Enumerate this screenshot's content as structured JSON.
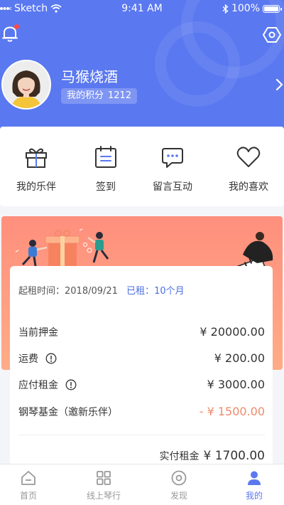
{
  "status_bar": {
    "carrier": "Sketch",
    "time": "9:41 AM",
    "battery": "100%"
  },
  "profile": {
    "name": "马猴烧酒",
    "points_label": "我的积分",
    "points_value": "1212"
  },
  "quick_actions": [
    {
      "label": "我的乐伴",
      "icon": "gift-icon"
    },
    {
      "label": "签到",
      "icon": "calendar-icon"
    },
    {
      "label": "留言互动",
      "icon": "chat-icon"
    },
    {
      "label": "我的喜欢",
      "icon": "heart-icon"
    }
  ],
  "rental": {
    "start_label": "起租时间：",
    "start_date": "2018/09/21",
    "rented_label": "已租：",
    "rented_value": "10个月",
    "deposit_label": "当前押金",
    "deposit_value": "¥ 20000.00",
    "shipping_label": "运费",
    "shipping_value": "¥ 200.00",
    "rent_due_label": "应付租金",
    "rent_due_value": "¥ 3000.00",
    "fund_label": "钢琴基金（邀新乐伴）",
    "fund_value": "- ¥ 1500.00",
    "actual_label": "实付租金",
    "actual_value": "¥ 1700.00"
  },
  "tabs": [
    {
      "label": "首页",
      "icon": "home-icon"
    },
    {
      "label": "线上琴行",
      "icon": "grid-icon"
    },
    {
      "label": "发现",
      "icon": "discover-icon"
    },
    {
      "label": "我的",
      "icon": "user-icon",
      "active": true
    }
  ],
  "colors": {
    "primary": "#5a78f0",
    "banner": "#ff9d82",
    "negative": "#f08a6a"
  }
}
